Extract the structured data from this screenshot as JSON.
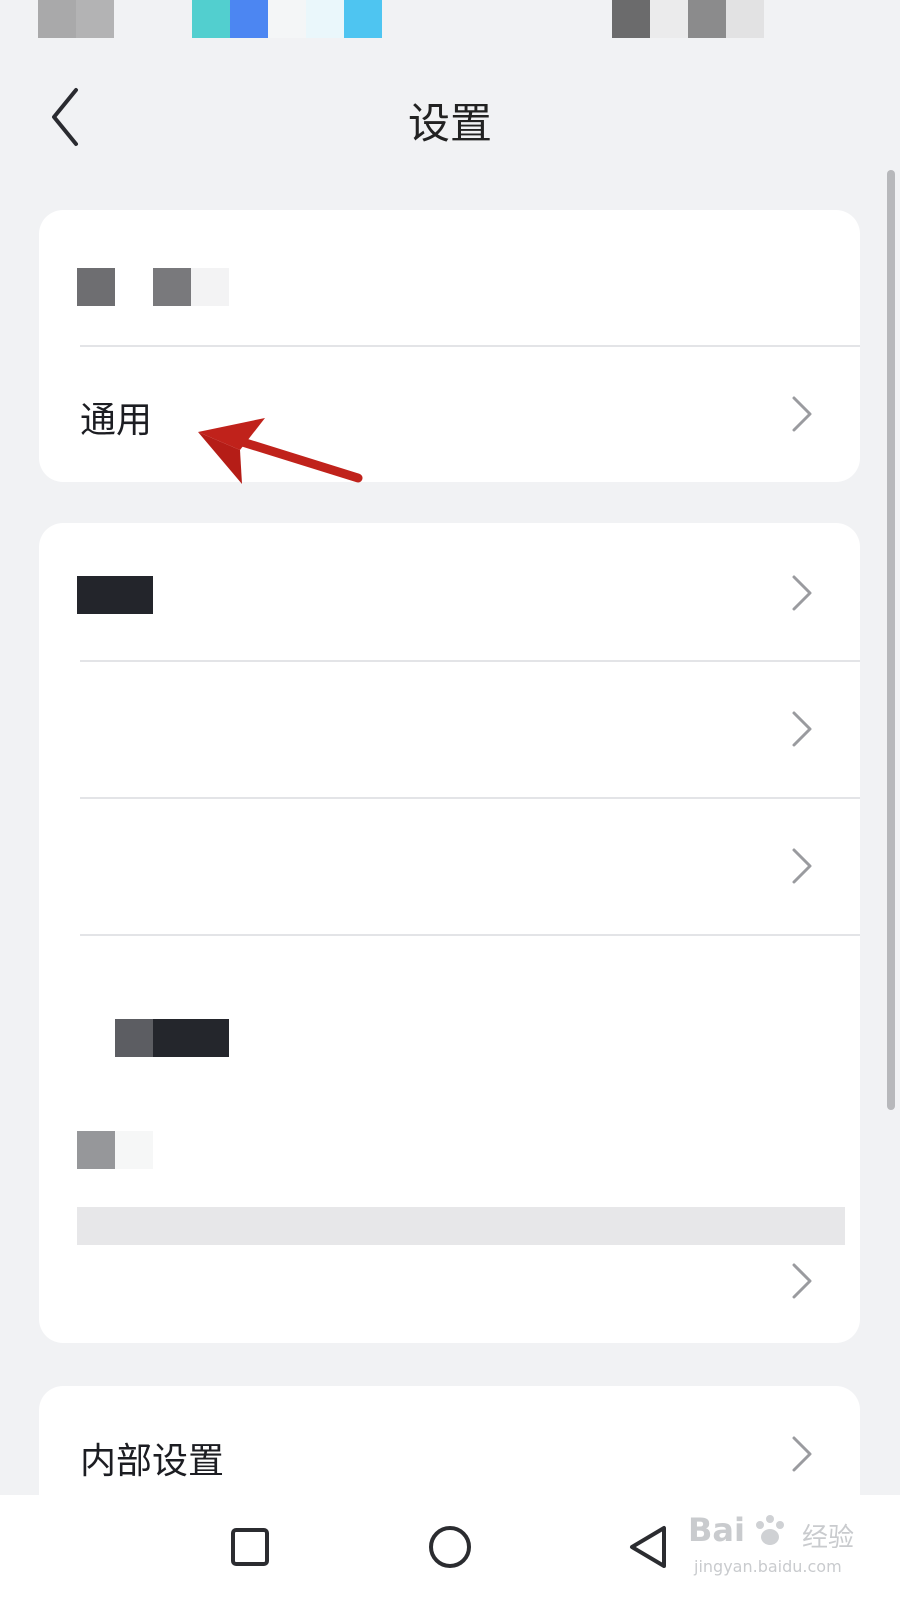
{
  "header": {
    "title": "设置",
    "back_icon": "back-chevron-icon"
  },
  "cards": {
    "group1": {
      "general_label": "通用"
    },
    "group3": {
      "internal_settings_label": "内部设置"
    }
  },
  "nav": {
    "recents_icon": "square-icon",
    "home_icon": "circle-icon",
    "back_icon": "triangle-back-icon"
  },
  "watermark": {
    "brand": "Bai",
    "sub": "经验",
    "url": "jingyan.baidu.com"
  },
  "colors": {
    "background": "#f1f2f4",
    "card": "#ffffff",
    "annotation_arrow": "#c0221b",
    "text": "#1c1d22"
  }
}
